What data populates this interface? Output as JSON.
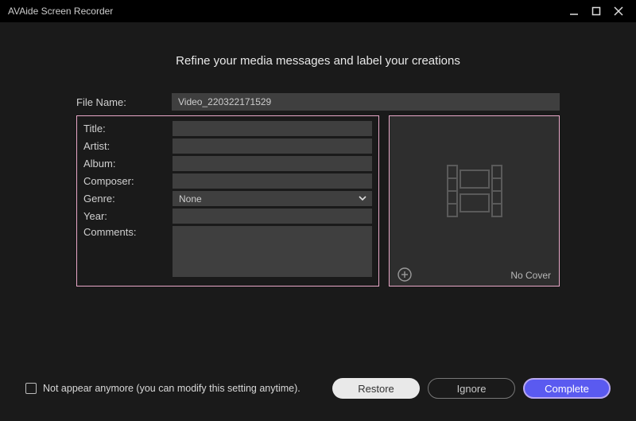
{
  "app_title": "AVAide Screen Recorder",
  "heading": "Refine your media messages and label your creations",
  "filename_label": "File Name:",
  "filename_value": "Video_220322171529",
  "fields": {
    "title_label": "Title:",
    "title_value": "",
    "artist_label": "Artist:",
    "artist_value": "",
    "album_label": "Album:",
    "album_value": "",
    "composer_label": "Composer:",
    "composer_value": "",
    "genre_label": "Genre:",
    "genre_value": "None",
    "year_label": "Year:",
    "year_value": "",
    "comments_label": "Comments:",
    "comments_value": ""
  },
  "cover": {
    "no_cover_text": "No Cover"
  },
  "footer": {
    "checkbox_label": "Not appear anymore (you can modify this setting anytime).",
    "restore": "Restore",
    "ignore": "Ignore",
    "complete": "Complete"
  }
}
